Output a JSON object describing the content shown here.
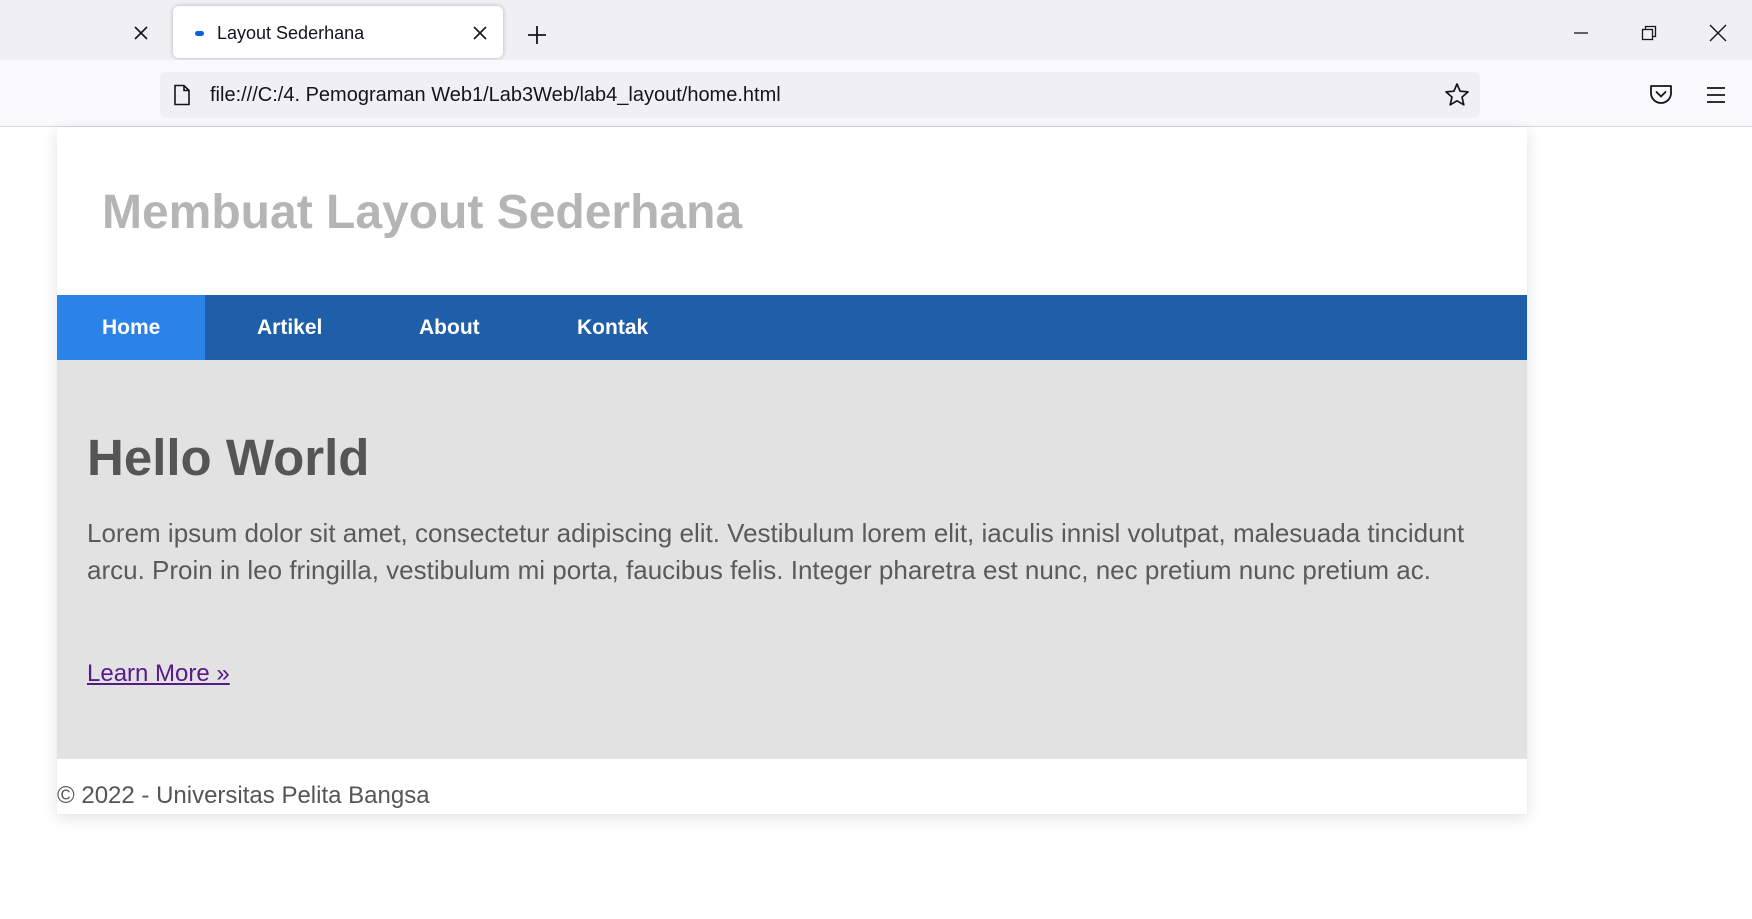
{
  "browser": {
    "active_tab_title": "Layout Sederhana",
    "url": "file:///C:/4. Pemograman Web1/Lab3Web/lab4_layout/home.html",
    "icons": [
      "close-icon",
      "new-tab-icon",
      "minimize-icon",
      "restore-icon",
      "page-icon",
      "bookmark-star-icon",
      "pocket-icon",
      "hamburger-menu-icon"
    ]
  },
  "site": {
    "title": "Membuat Layout Sederhana",
    "nav": [
      {
        "label": "Home",
        "active": true
      },
      {
        "label": "Artikel",
        "active": false
      },
      {
        "label": "About",
        "active": false
      },
      {
        "label": "Kontak",
        "active": false
      }
    ],
    "hero": {
      "heading": "Hello World",
      "body": "Lorem ipsum dolor sit amet, consectetur adipiscing elit. Vestibulum lorem elit, iaculis innisl volutpat, malesuada tincidunt arcu. Proin in leo fringilla, vestibulum mi porta, faucibus felis. Integer pharetra est nunc, nec pretium nunc pretium ac.",
      "link": "Learn More »"
    },
    "footer": "© 2022 - Universitas Pelita Bangsa"
  },
  "colors": {
    "nav_bg": "#1f5faa",
    "nav_active_bg": "#2b83ea",
    "hero_bg": "#e2e2e2",
    "title_color": "#b5b5b5",
    "link_visited": "#551a8b"
  }
}
